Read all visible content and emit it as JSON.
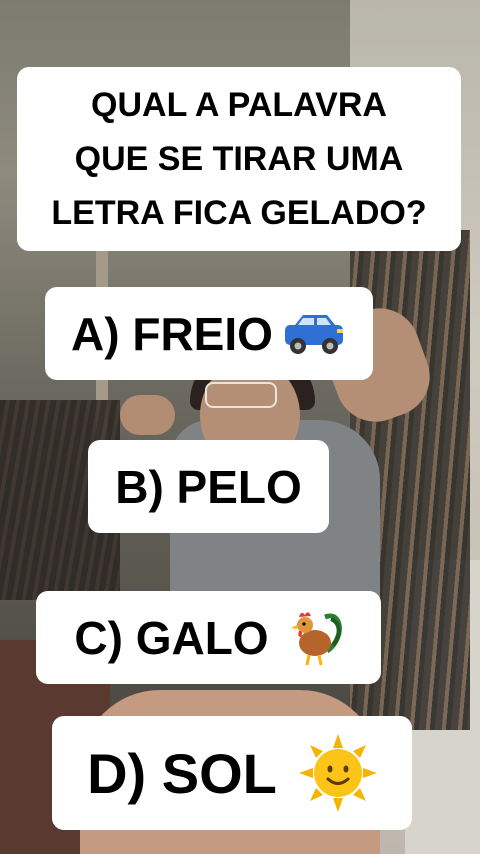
{
  "question": {
    "lines": [
      "QUAL A PALAVRA",
      "QUE SE TIRAR UMA",
      "LETRA FICA GELADO?"
    ]
  },
  "options": [
    {
      "label": "A) FREIO",
      "icon": "car-icon"
    },
    {
      "label": "B) PELO",
      "icon": ""
    },
    {
      "label": "C) GALO",
      "icon": "rooster-icon"
    },
    {
      "label": "D) SOL",
      "icon": "sun-icon"
    }
  ],
  "colors": {
    "card_bg": "#ffffff",
    "text": "#000000",
    "car": "#2f6fd6",
    "sun": "#f5b400"
  }
}
